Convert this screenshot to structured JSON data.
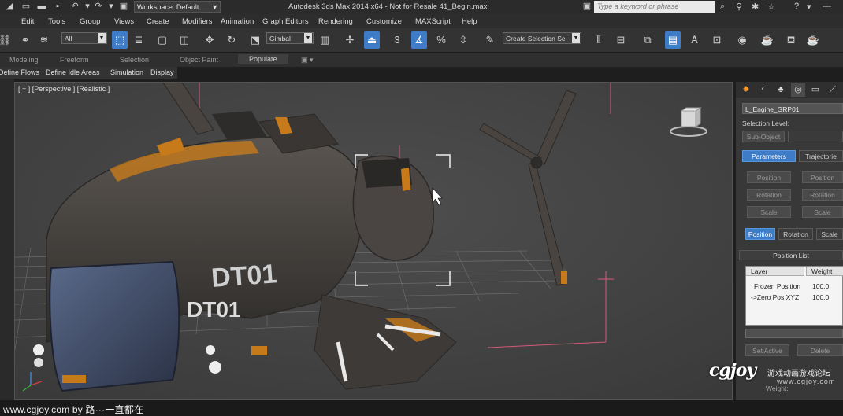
{
  "title_bar": {
    "workspace": "Workspace: Default",
    "app_title": "Autodesk 3ds Max  2014 x64   - Not for Resale   41_Begin.max",
    "search_placeholder": "Type a keyword or phrase"
  },
  "menu": [
    "Edit",
    "Tools",
    "Group",
    "Views",
    "Create",
    "Modifiers",
    "Animation",
    "Graph Editors",
    "Rendering",
    "Customize",
    "MAXScript",
    "Help"
  ],
  "toolbar": {
    "selection_filter": "All",
    "ref_coord": "Gimbal",
    "angle_snap": "3",
    "named_selection": "Create Selection Se"
  },
  "ribbon_tabs": [
    "Modeling",
    "Freeform",
    "Selection",
    "Object Paint",
    "Populate"
  ],
  "ribbon_active": "Populate",
  "sub_ribbon": [
    "Define Flows",
    "Define Idle Areas",
    "Simulation",
    "Display"
  ],
  "viewport": {
    "label": "[ + ] [Perspective ] [Realistic ]",
    "hull_text": "DT01",
    "fuselage_text": "DT01",
    "colors": {
      "bg": "#444444",
      "grid": "#8a8a8a",
      "hull": "#3a3a3a",
      "rust": "#c77a1a",
      "axis_pink": "#d45a7a"
    }
  },
  "command_panel": {
    "object_name": "L_Engine_GRP01",
    "selection_level_label": "Selection Level:",
    "sub_object": "Sub-Object",
    "tab_parameters": "Parameters",
    "tab_trajectories": "Trajectorie",
    "left_buttons": [
      "Position",
      "Rotation",
      "Scale"
    ],
    "right_buttons": [
      "Position",
      "Rotation",
      "Scale"
    ],
    "controller_tabs": [
      "Position",
      "Rotation",
      "Scale"
    ],
    "controller_active": "Position",
    "position_list_title": "Position List",
    "list_headers": [
      "Layer",
      "Weight"
    ],
    "list_rows": [
      {
        "layer": "Frozen Position",
        "weight": "100.0"
      },
      {
        "layer": "->Zero Pos XYZ",
        "weight": "100.0"
      }
    ],
    "set_active": "Set Active",
    "delete": "Delete",
    "weight_label": "Weight:"
  },
  "overlay": {
    "site": "www.cgjoy.com by 路···一直都在",
    "logo": "CGJOY",
    "logo_cn": "游戏动画游戏论坛",
    "logo_url": "www.cgjoy.com"
  }
}
